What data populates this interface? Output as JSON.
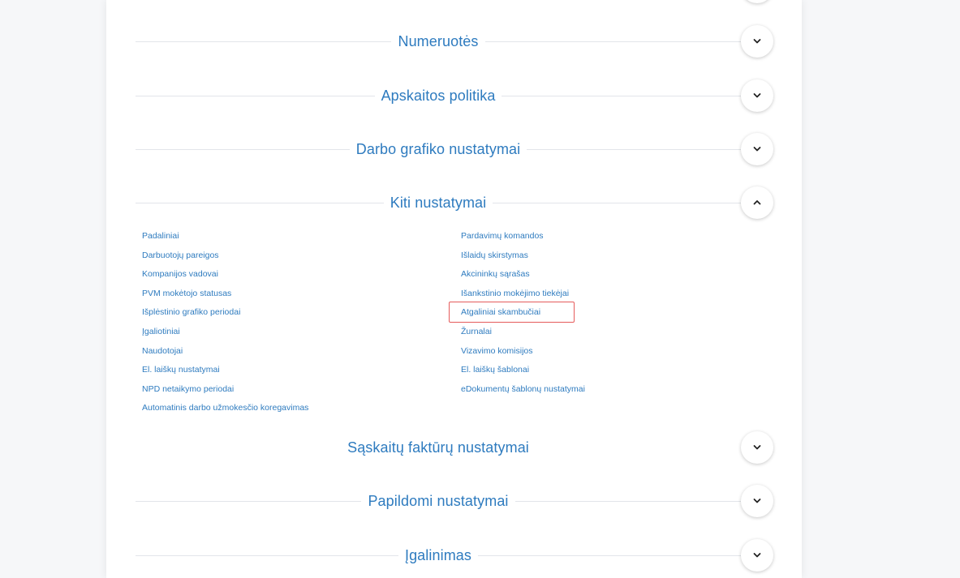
{
  "sections": {
    "numeruotes": {
      "title": "Numeruotės",
      "expanded": false
    },
    "apskaitos": {
      "title": "Apskaitos politika",
      "expanded": false
    },
    "darbo": {
      "title": "Darbo grafiko nustatymai",
      "expanded": false
    },
    "kiti": {
      "title": "Kiti nustatymai",
      "expanded": true
    },
    "saskaitu": {
      "title": "Sąskaitų faktūrų nustatymai",
      "expanded": false
    },
    "papildomi": {
      "title": "Papildomi nustatymai",
      "expanded": false
    },
    "igalinimas": {
      "title": "Įgalinimas",
      "expanded": false
    }
  },
  "kiti_links": {
    "left": [
      "Padaliniai",
      "Darbuotojų pareigos",
      "Kompanijos vadovai",
      "PVM mokėtojo statusas",
      "Išplėstinio grafiko periodai",
      "Įgaliotiniai",
      "Naudotojai",
      "El. laiškų nustatymai",
      "NPD netaikymo periodai",
      "Automatinis darbo užmokesčio koregavimas"
    ],
    "right": [
      "Pardavimų komandos",
      "Išlaidų skirstymas",
      "Akcininkų sąrašas",
      "Išankstinio mokėjimo tiekėjai",
      "Atgaliniai skambučiai",
      "Žurnalai",
      "Vizavimo komisijos",
      "El. laiškų šablonai",
      "eDokumentų šablonų nustatymai"
    ]
  },
  "colors": {
    "accent": "#2e7bbf",
    "highlight": "#e55b5b"
  },
  "icons": {
    "collapsed": "chevron-down-icon",
    "expanded": "chevron-up-icon"
  }
}
